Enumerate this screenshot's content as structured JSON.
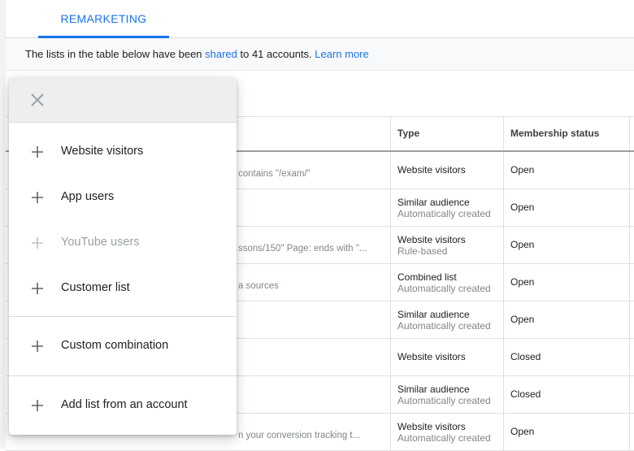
{
  "tabs": [
    {
      "label": "REMARKETING",
      "active": true
    }
  ],
  "banner": {
    "prefix": "The lists in the table below have been ",
    "link_shared": "shared",
    "middle": " to 41 accounts. ",
    "link_learn": "Learn more"
  },
  "table": {
    "headers": {
      "type": "Type",
      "status": "Membership status"
    },
    "rows": [
      {
        "rule": "contains \"/exam/\"",
        "type": "Website visitors",
        "type_sub": "",
        "status": "Open"
      },
      {
        "rule": "",
        "type": "Similar audience",
        "type_sub": "Automatically created",
        "status": "Open"
      },
      {
        "rule": "ssons/150\" Page: ends with \"...",
        "type": "Website visitors",
        "type_sub": "Rule-based",
        "status": "Open"
      },
      {
        "rule": "a sources",
        "type": "Combined list",
        "type_sub": "Automatically created",
        "status": "Open"
      },
      {
        "rule": "",
        "type": "Similar audience",
        "type_sub": "Automatically created",
        "status": "Open"
      },
      {
        "rule": "",
        "type": "Website visitors",
        "type_sub": "",
        "status": "Closed"
      },
      {
        "rule": "",
        "type": "Similar audience",
        "type_sub": "Automatically created",
        "status": "Closed"
      },
      {
        "rule": "n your conversion tracking t...",
        "type": "Website visitors",
        "type_sub": "Automatically created",
        "status": "Open"
      }
    ]
  },
  "menu": {
    "close_icon": "close-icon",
    "items": [
      {
        "label": "Website visitors",
        "enabled": true
      },
      {
        "label": "App users",
        "enabled": true
      },
      {
        "label": "YouTube users",
        "enabled": false
      },
      {
        "label": "Customer list",
        "enabled": true
      },
      {
        "label": "Custom combination",
        "enabled": true
      },
      {
        "label": "Add list from an account",
        "enabled": true
      }
    ]
  },
  "colors": {
    "accent": "#1a73e8",
    "disabled_text": "#9aa0a6",
    "secondary_text": "#80868b"
  }
}
